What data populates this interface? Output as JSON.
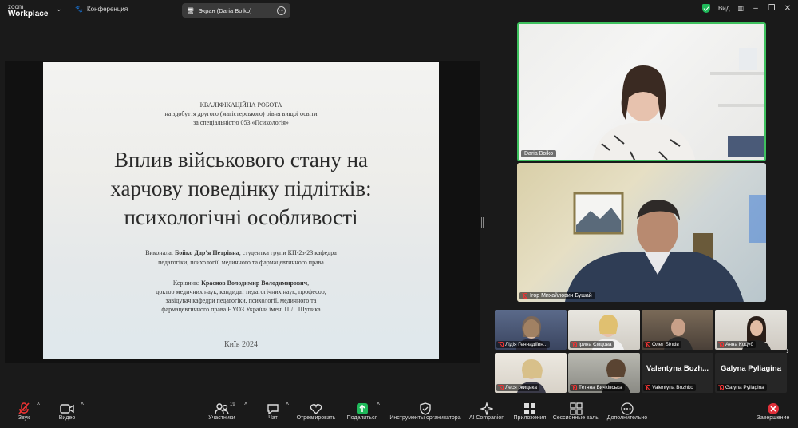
{
  "app": {
    "logo_line1": "zoom",
    "logo_line2": "Workplace"
  },
  "top": {
    "meeting_label": "Конференция",
    "share_label": "Экран (Daria Boiko)",
    "view_label": "Вид"
  },
  "slide": {
    "line1": "КВАЛІФІКАЦІЙНА РОБОТА",
    "line2": "на здобуття другого (магістерського) рівня вищої освіти",
    "line3": "за спеціальністю 053 «Психологія»",
    "title1": "Вплив військового стану на",
    "title2": "харчову поведінку підлітків:",
    "title3": "психологічні особливості",
    "author_prefix": "Виконала: ",
    "author_name": "Бойко Дар’я Петрівна",
    "author_rest": ", студентка групи КП-2з-23 кафедра",
    "author_line2": "педагогіки, психології, медичного та фармацевтичного права",
    "sup_prefix": "Керівник: ",
    "sup_name": "Краснов Володимир Володимирович",
    "sup_comma": ",",
    "sup_line2": "доктор медичних наук, кандидат педагогічних наук, професор,",
    "sup_line3": "завідувач кафедри педагогіки, психології, медичного та",
    "sup_line4": "фармацевтичного права НУОЗ України імені П.Л. Шупика",
    "city": "Київ 2024"
  },
  "speakers": [
    {
      "name": "Daria Boiko"
    },
    {
      "name": "Ігор Михайлович Бушай"
    }
  ],
  "gallery": [
    {
      "name": "Лідія Геннадіївн...",
      "video": true
    },
    {
      "name": "Ірина Ємцова",
      "video": true
    },
    {
      "name": "Олег Білків",
      "video": true
    },
    {
      "name": "Анна Коцуб",
      "video": true
    },
    {
      "name": "Леся Іжицька",
      "video": true
    },
    {
      "name": "Тетяна Бичківська",
      "video": true
    },
    {
      "name": "Valentyna Bozhko",
      "display": "Valentyna Bozh...",
      "video": false
    },
    {
      "name": "Galyna Pyliagina",
      "display": "Galyna Pyliagina",
      "video": false
    }
  ],
  "toolbar": {
    "audio": "Звук",
    "video": "Видео",
    "participants": "Участники",
    "participants_count": "19",
    "chat": "Чат",
    "react": "Отреагировать",
    "share": "Поделиться",
    "host_tools": "Инструменты организатора",
    "ai": "AI Companion",
    "apps": "Приложения",
    "rooms": "Сессионные залы",
    "more": "Дополнительно",
    "end": "Завершение"
  },
  "colors": {
    "active_speaker": "#3ec05e",
    "share_green": "#1fb95a",
    "end_red": "#e0303a",
    "muted_red": "#e33333"
  }
}
